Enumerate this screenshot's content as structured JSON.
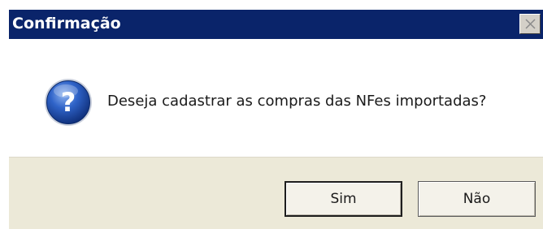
{
  "window": {
    "title": "Confirmação",
    "close_icon": "close-icon"
  },
  "dialog": {
    "icon": "question-icon",
    "icon_glyph": "?",
    "message": "Deseja cadastrar as compras das NFes importadas?"
  },
  "buttons": {
    "yes_label": "Sim",
    "no_label": "Não"
  },
  "colors": {
    "titlebar": "#0a246a",
    "footer": "#ece9d8",
    "icon_blue": "#1f4fa8"
  }
}
